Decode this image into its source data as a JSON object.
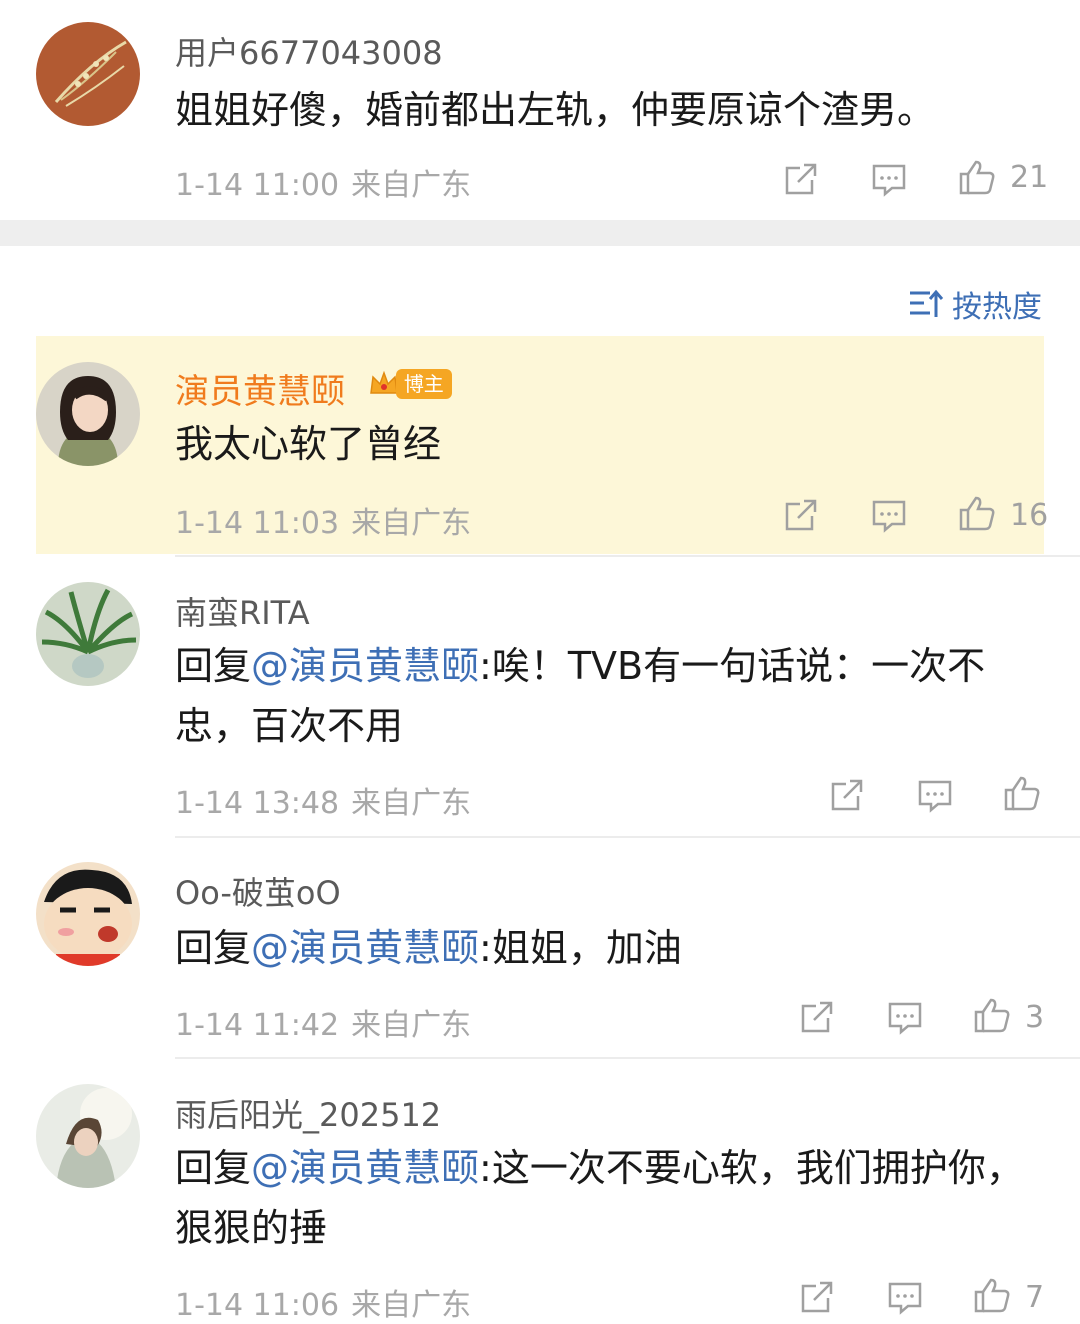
{
  "sort": {
    "label": "按热度",
    "icon": "sort-icon"
  },
  "comments": [
    {
      "user": "用户6677043008",
      "text": "姐姐好傻，婚前都出左轨，仲要原谅个渣男。",
      "time": "1-14 11:00",
      "location": "来自广东",
      "likes": "21"
    },
    {
      "user": "演员黄慧颐",
      "badge": "博主",
      "text": "我太心软了曾经",
      "time": "1-14 11:03",
      "location": "来自广东",
      "likes": "16",
      "highlight_color": "#fdf7d8"
    },
    {
      "user": "南蛮RITA",
      "reply_prefix": "回复",
      "mention": "@演员黄慧颐",
      "text": ":唉！TVB有一句话说：一次不忠，百次不用",
      "time": "1-14 13:48",
      "location": "来自广东",
      "likes": ""
    },
    {
      "user": "Oo-破茧oO",
      "reply_prefix": "回复",
      "mention": "@演员黄慧颐",
      "text": ":姐姐，加油",
      "time": "1-14 11:42",
      "location": "来自广东",
      "likes": "3"
    },
    {
      "user": "雨后阳光_202512",
      "reply_prefix": "回复",
      "mention": "@演员黄慧颐",
      "text": ":这一次不要心软，我们拥护你，狠狠的捶",
      "time": "1-14 11:06",
      "location": "来自广东",
      "likes": "7"
    }
  ],
  "colors": {
    "mention": "#3e6fb5",
    "author_name": "#f07b1d",
    "meta": "#a8a8a8"
  }
}
